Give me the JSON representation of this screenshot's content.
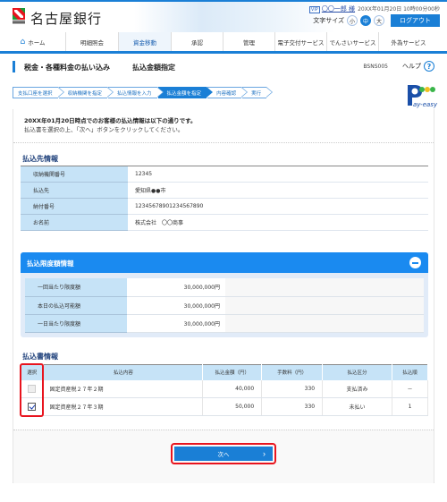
{
  "header": {
    "bank_name": "名古屋銀行",
    "user_badge": "VIP",
    "user_name": "〇〇一郎 様",
    "timestamp": "20XX年01月20日 10時00分00秒",
    "font_size_label": "文字サイズ",
    "font_sizes": [
      "小",
      "中",
      "大"
    ],
    "font_size_selected": "中",
    "logout_label": "ログアウト"
  },
  "nav": {
    "items": [
      {
        "label": "ホーム",
        "icon": "home-icon"
      },
      {
        "label": "明細照会"
      },
      {
        "label": "資金移動",
        "active": true
      },
      {
        "label": "承認"
      },
      {
        "label": "管理"
      },
      {
        "label": "電子交付サービス"
      },
      {
        "label": "でんさいサービス"
      },
      {
        "label": "外為サービス"
      }
    ]
  },
  "page": {
    "title": "税金・各種料金の払い込み",
    "subtitle": "払込金額指定",
    "screen_id": "BSNS005",
    "help_label": "ヘルプ",
    "help_icon": "?"
  },
  "steps": [
    {
      "label": "支払口座を選択"
    },
    {
      "label": "収納機関を指定"
    },
    {
      "label": "払込情報を入力"
    },
    {
      "label": "払込金額を指定",
      "active": true
    },
    {
      "label": "内容確認"
    },
    {
      "label": "実行"
    }
  ],
  "intro": {
    "line1": "20XX年01月20日時点でのお客様の払込情報は以下の通りです。",
    "line2": "払込書を選択の上、「次へ」ボタンをクリックしてください。"
  },
  "payee": {
    "title": "払込先情報",
    "rows": [
      {
        "label": "収納機関番号",
        "value": "12345"
      },
      {
        "label": "払込先",
        "value": "愛知県●●市"
      },
      {
        "label": "納付番号",
        "value": "12345678901234567890"
      },
      {
        "label": "お名前",
        "value": "株式会社　〇〇商事"
      }
    ]
  },
  "limits": {
    "title": "払込限度額情報",
    "rows": [
      {
        "label": "一回当たり限度額",
        "value": "30,000,000円"
      },
      {
        "label": "本日の払込可能額",
        "value": "30,000,000円"
      },
      {
        "label": "一日当たり限度額",
        "value": "30,000,000円"
      }
    ]
  },
  "bills": {
    "title": "払込書情報",
    "columns": [
      "選択",
      "払込内容",
      "払込金額（円）",
      "手数料（円）",
      "払込区分",
      "払込順"
    ],
    "rows": [
      {
        "checked": false,
        "disabled": true,
        "content": "固定資産税２７年２期",
        "amount": "40,000",
        "fee": "330",
        "status": "支払済み",
        "order": "－"
      },
      {
        "checked": true,
        "disabled": false,
        "content": "固定資産税２７年３期",
        "amount": "50,000",
        "fee": "330",
        "status": "未払い",
        "order": "1"
      }
    ]
  },
  "actions": {
    "next_label": "次へ",
    "next_chevron": "›"
  },
  "colors": {
    "accent": "#1a7fd6",
    "highlight": "#e8141e",
    "table_header": "#c6e3f7"
  }
}
